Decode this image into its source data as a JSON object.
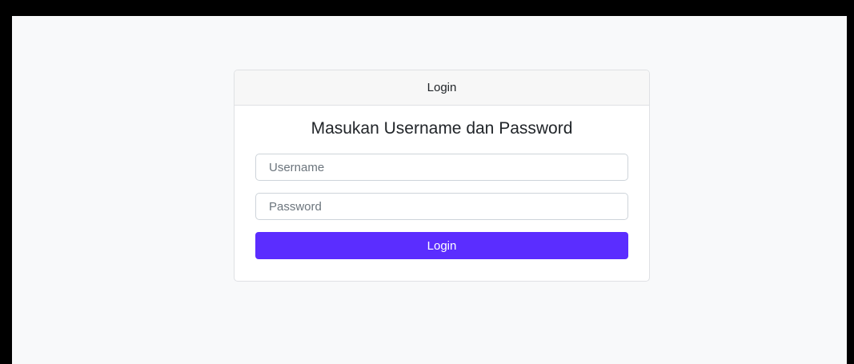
{
  "colors": {
    "frame": "#000000",
    "page_background": "#f8f9fa",
    "card_header_background": "#f7f7f7",
    "primary_button": "#5b2dff"
  },
  "card": {
    "header": "Login",
    "title": "Masukan Username dan Password"
  },
  "form": {
    "username_placeholder": "Username",
    "username_value": "",
    "password_placeholder": "Password",
    "password_value": "",
    "submit_label": "Login"
  }
}
